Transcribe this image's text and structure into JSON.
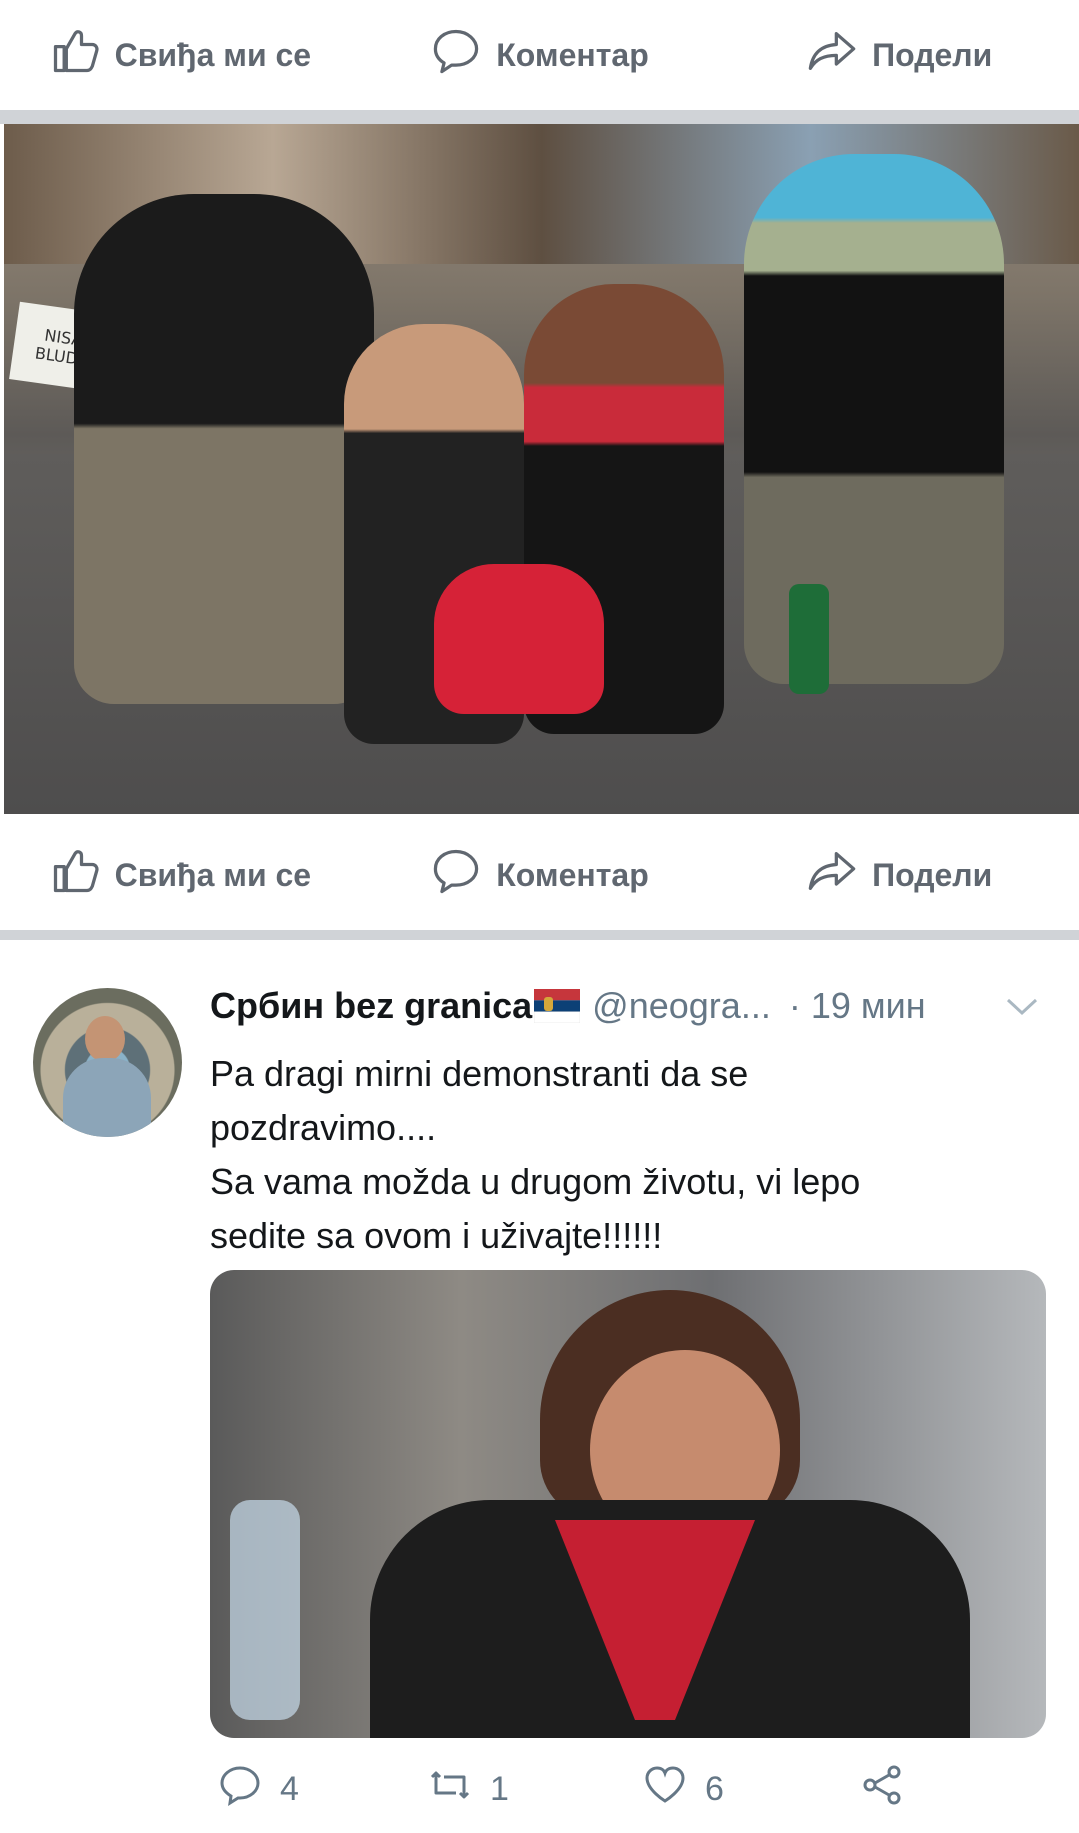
{
  "actions": {
    "like": "Свиђа ми се",
    "comment": "Коментар",
    "share": "Подели"
  },
  "photo_signs": [
    "NISAM",
    "BLUDAN"
  ],
  "tweet": {
    "name": "Србин bez granica",
    "handle": "@neogra...",
    "time": "· 19 мин",
    "text_lines": [
      "Pa dragi mirni demonstranti da se",
      "pozdravimo....",
      "Sa vama možda u drugom životu, vi lepo",
      "sedite sa ovom i uživajte!!!!!!"
    ],
    "reply_count": "4",
    "retweet_count": "1",
    "like_count": "6"
  },
  "colors": {
    "action_text": "#606770",
    "divider": "#d0d3d7",
    "tweet_meta": "#657786"
  }
}
